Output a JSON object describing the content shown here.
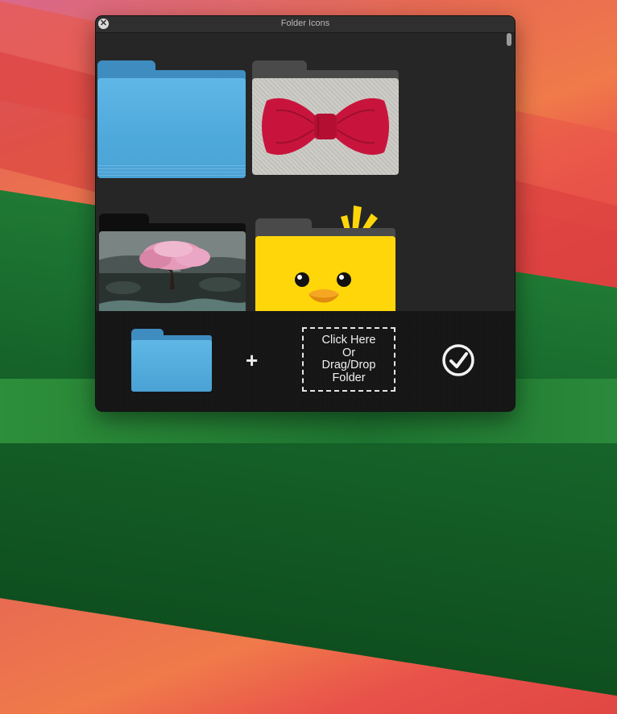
{
  "window": {
    "title": "Folder Icons",
    "close_glyph": "✕"
  },
  "grid": {
    "tiles": [
      {
        "name": "blue-folder",
        "color": "#4ea9db"
      },
      {
        "name": "bow-tie-folder",
        "color": "#c8143c"
      },
      {
        "name": "blossom-tree-folder",
        "color": "#e7a3c3"
      },
      {
        "name": "duck-folder",
        "color": "#ffd60a"
      }
    ]
  },
  "bottom_bar": {
    "plus_label": "+",
    "drop_zone_text": "Click Here\nOr\nDrag/Drop\nFolder",
    "confirm_icon": "checkmark-circle-icon"
  },
  "colors": {
    "folder_blue": "#4ea9db",
    "window_bg": "#262626",
    "bottom_bg": "#151515"
  }
}
